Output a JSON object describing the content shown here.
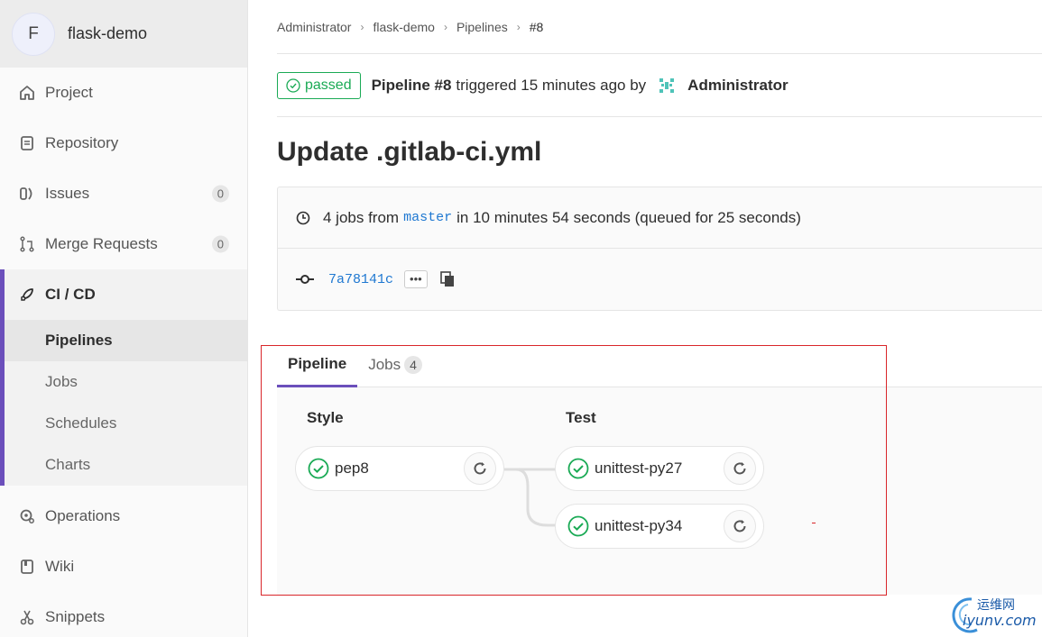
{
  "sidebar": {
    "project_initial": "F",
    "project_name": "flask-demo",
    "items": [
      {
        "label": "Project",
        "icon": "home-icon"
      },
      {
        "label": "Repository",
        "icon": "doc-icon"
      },
      {
        "label": "Issues",
        "icon": "issues-icon",
        "count": "0"
      },
      {
        "label": "Merge Requests",
        "icon": "merge-icon",
        "count": "0"
      },
      {
        "label": "CI / CD",
        "icon": "rocket-icon"
      },
      {
        "label": "Operations",
        "icon": "operations-icon"
      },
      {
        "label": "Wiki",
        "icon": "book-icon"
      },
      {
        "label": "Snippets",
        "icon": "scissors-icon"
      }
    ],
    "cicd_sub": [
      "Pipelines",
      "Jobs",
      "Schedules",
      "Charts"
    ]
  },
  "breadcrumb": [
    "Administrator",
    "flask-demo",
    "Pipelines",
    "#8"
  ],
  "pipeline": {
    "status": "passed",
    "id_label": "Pipeline #8",
    "triggered_text": "triggered 15 minutes ago by",
    "user": "Administrator"
  },
  "commit_title": "Update .gitlab-ci.yml",
  "info": {
    "jobs_prefix": "4 jobs from",
    "branch": "master",
    "jobs_suffix": "in 10 minutes 54 seconds (queued for 25 seconds)",
    "sha": "7a78141c",
    "dots": "•••"
  },
  "tabs": [
    {
      "label": "Pipeline"
    },
    {
      "label": "Jobs",
      "count": "4"
    }
  ],
  "stages": [
    {
      "title": "Style",
      "jobs": [
        "pep8"
      ]
    },
    {
      "title": "Test",
      "jobs": [
        "unittest-py27",
        "unittest-py34"
      ]
    }
  ],
  "watermark": {
    "cn": "运维网",
    "en": "iyunv.com"
  },
  "colors": {
    "success": "#1aaa55",
    "accent": "#6b4fbb",
    "link": "#1f78d1",
    "annotation": "#d9262a"
  }
}
